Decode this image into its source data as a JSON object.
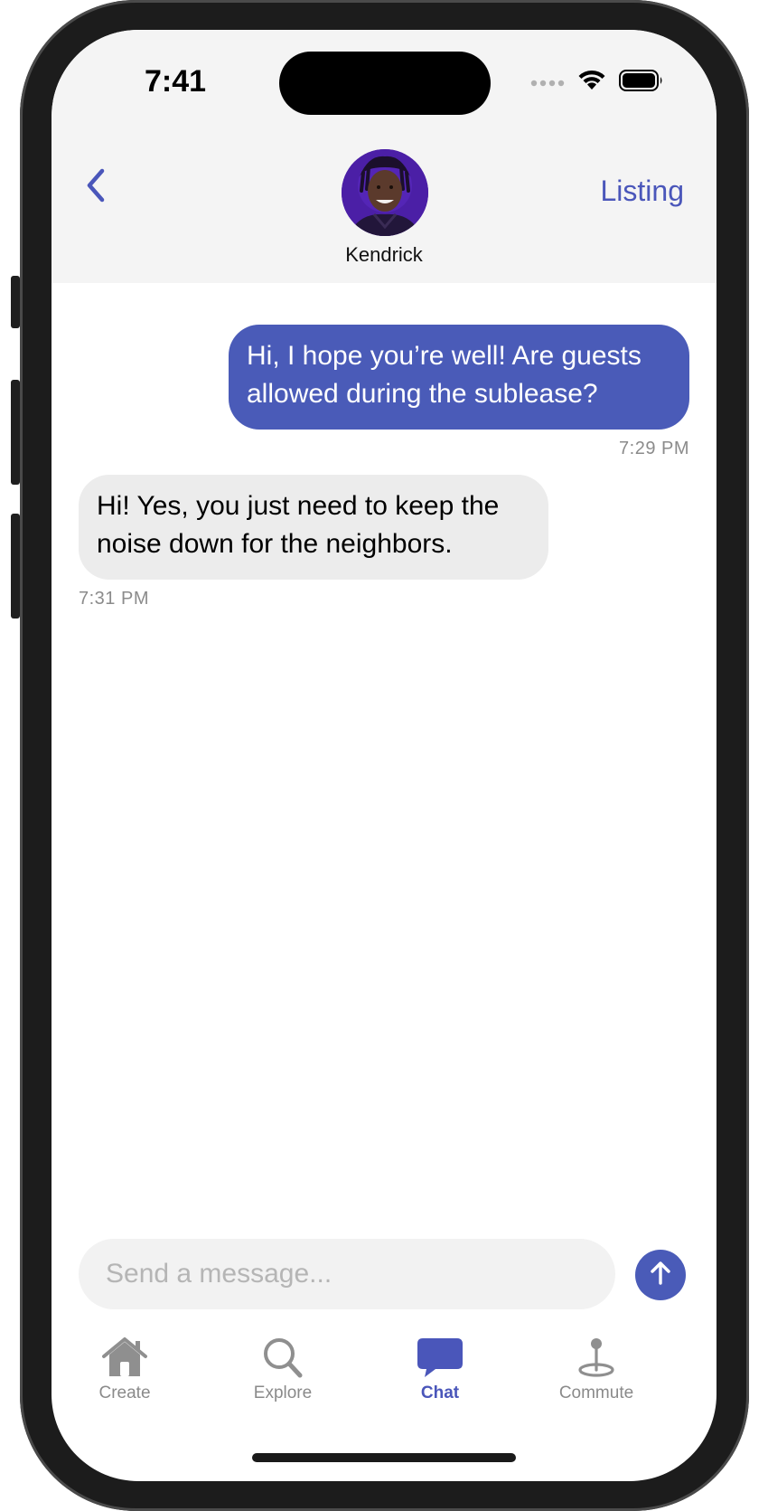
{
  "status_bar": {
    "time": "7:41",
    "icons": [
      "signal-dots-icon",
      "wifi-icon",
      "battery-icon"
    ]
  },
  "header": {
    "back_icon": "chevron-left-icon",
    "contact_name": "Kendrick",
    "listing_label": "Listing"
  },
  "messages": [
    {
      "direction": "outgoing",
      "text": "Hi, I hope you’re well! Are guests allowed during the sublease?",
      "time": "7:29 PM"
    },
    {
      "direction": "incoming",
      "text": "Hi! Yes, you just need to keep the noise down for the neighbors.",
      "time": "7:31 PM"
    }
  ],
  "composer": {
    "placeholder": "Send a message...",
    "send_icon": "arrow-up-icon"
  },
  "tabs": [
    {
      "label": "Create",
      "icon": "house-icon",
      "active": false
    },
    {
      "label": "Explore",
      "icon": "magnifier-icon",
      "active": false
    },
    {
      "label": "Chat",
      "icon": "chat-bubble-icon",
      "active": true
    },
    {
      "label": "Commute",
      "icon": "map-pin-icon",
      "active": false
    }
  ],
  "colors": {
    "accent": "#4a5bb8",
    "accent_text": "#4a56ba",
    "incoming_bubble": "#ececec",
    "header_bg": "#f4f4f4"
  }
}
